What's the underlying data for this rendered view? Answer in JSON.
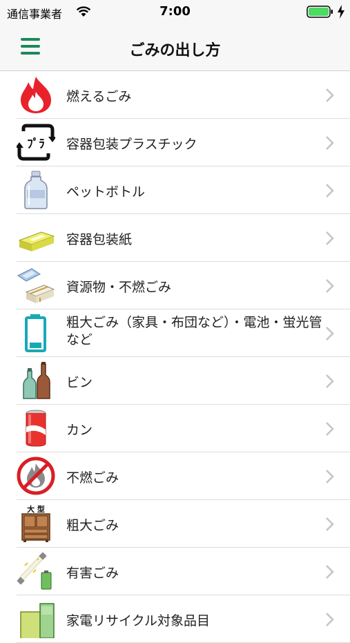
{
  "status_bar": {
    "carrier": "通信事業者",
    "time": "7:00"
  },
  "header": {
    "title": "ごみの出し方"
  },
  "items": [
    {
      "label": "燃えるごみ",
      "icon": "flame-icon"
    },
    {
      "label": "容器包装プラスチック",
      "icon": "plastic-recycle-icon"
    },
    {
      "label": "ペットボトル",
      "icon": "pet-bottle-icon"
    },
    {
      "label": "容器包装紙",
      "icon": "paper-box-icon"
    },
    {
      "label": "資源物・不燃ごみ",
      "icon": "newspaper-bundle-icon"
    },
    {
      "label": "粗大ごみ（家具・布団など）・電池・蛍光管など",
      "icon": "battery-icon"
    },
    {
      "label": "ビン",
      "icon": "glass-bottle-icon"
    },
    {
      "label": "カン",
      "icon": "can-icon"
    },
    {
      "label": "不燃ごみ",
      "icon": "no-burn-icon"
    },
    {
      "label": "粗大ごみ",
      "icon": "furniture-icon",
      "badge": "大 型"
    },
    {
      "label": "有害ごみ",
      "icon": "fluorescent-lamp-icon"
    },
    {
      "label": "家電リサイクル対象品目",
      "icon": "appliance-icon"
    }
  ],
  "colors": {
    "accent": "#1a8a5a",
    "flame": "#e8222a",
    "battery": "#19a9b3"
  }
}
